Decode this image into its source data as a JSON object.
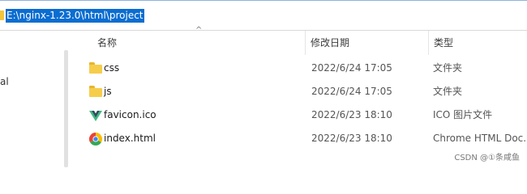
{
  "address_bar": {
    "path": "E:\\nginx-1.23.0\\html\\project"
  },
  "nav_pane": {
    "partial_label": "al"
  },
  "columns": {
    "name": "名称",
    "date": "修改日期",
    "type": "类型",
    "sort_indicator": "^"
  },
  "files": [
    {
      "name": "css",
      "modified": "2022/6/24 17:05",
      "type": "文件夹",
      "icon": "folder-icon"
    },
    {
      "name": "js",
      "modified": "2022/6/24 17:05",
      "type": "文件夹",
      "icon": "folder-icon"
    },
    {
      "name": "favicon.ico",
      "modified": "2022/6/23 18:10",
      "type": "ICO 图片文件",
      "icon": "vue-logo-icon"
    },
    {
      "name": "index.html",
      "modified": "2022/6/23 18:10",
      "type": "Chrome HTML Doc...",
      "icon": "chrome-icon"
    }
  ],
  "watermark": "CSDN @①条咸鱼",
  "colors": {
    "selection": "#0a6dd1",
    "folder": "#f6cd4b"
  }
}
